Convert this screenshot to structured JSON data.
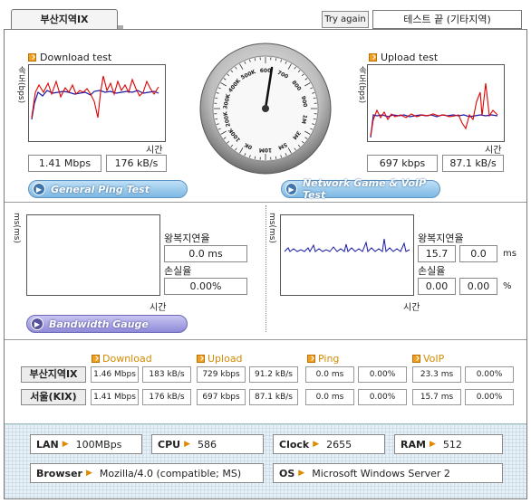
{
  "tab": {
    "label": "부산지역IX"
  },
  "toolbar": {
    "try_again_label": "Try again",
    "status_text": "테스트 끝 (기타지역)"
  },
  "download": {
    "title": "Download test",
    "y_label": "속도(bps)",
    "x_label": "시간",
    "mbps": "1.41 Mbps",
    "kbs": "176 kB/s"
  },
  "upload": {
    "title": "Upload test",
    "y_label": "속도(bps)",
    "x_label": "시간",
    "kbps": "697 kbps",
    "kbs": "87.1 kB/s"
  },
  "gauge": {
    "labels": [
      "600",
      "700",
      "800",
      "900",
      "1M",
      "3M",
      "5M",
      "10M",
      "0K",
      "100K",
      "200K",
      "300K",
      "400K",
      "500K"
    ]
  },
  "buttons": {
    "general_ping": "General Ping Test",
    "network_game": "Network Game & VoIP Test",
    "bandwidth_gauge": "Bandwidth Gauge"
  },
  "ping_left": {
    "y_label": "ms(ms)",
    "x_label": "시간",
    "rtt_label": "왕복지연율",
    "rtt_value": "0.0 ms",
    "loss_label": "손실율",
    "loss_value": "0.00%"
  },
  "ping_right": {
    "y_label": "ms(ms)",
    "x_label": "시간",
    "rtt_label": "왕복지연율",
    "rtt_a": "15.7",
    "rtt_b": "0.0",
    "rtt_unit": "ms",
    "loss_label": "손실율",
    "loss_a": "0.00",
    "loss_b": "0.00",
    "loss_unit": "%"
  },
  "results": {
    "headers": {
      "download": "Download",
      "upload": "Upload",
      "ping": "Ping",
      "voip": "VoIP"
    },
    "rows": [
      {
        "label": "부산지역IX",
        "cells": [
          "1.46 Mbps",
          "183 kB/s",
          "729 kbps",
          "91.2 kB/s",
          "0.0 ms",
          "0.00%",
          "23.3 ms",
          "0.00%"
        ]
      },
      {
        "label": "서울(KIX)",
        "cells": [
          "1.41 Mbps",
          "176 kB/s",
          "697 kbps",
          "87.1 kB/s",
          "0.0 ms",
          "0.00%",
          "15.7 ms",
          "0.00%"
        ]
      }
    ]
  },
  "system": {
    "lan_key": "LAN",
    "lan_val": "100MBps",
    "cpu_key": "CPU",
    "cpu_val": "586",
    "clock_key": "Clock",
    "clock_val": "2655",
    "ram_key": "RAM",
    "ram_val": "512",
    "browser_key": "Browser",
    "browser_val": "Mozilla/4.0 (compatible; MS)",
    "os_key": "OS",
    "os_val": "Microsoft Windows Server 2"
  },
  "colors": {
    "series_red": "#e00000",
    "series_blue": "#1a1aa8",
    "accent_orange": "#e08a00"
  }
}
